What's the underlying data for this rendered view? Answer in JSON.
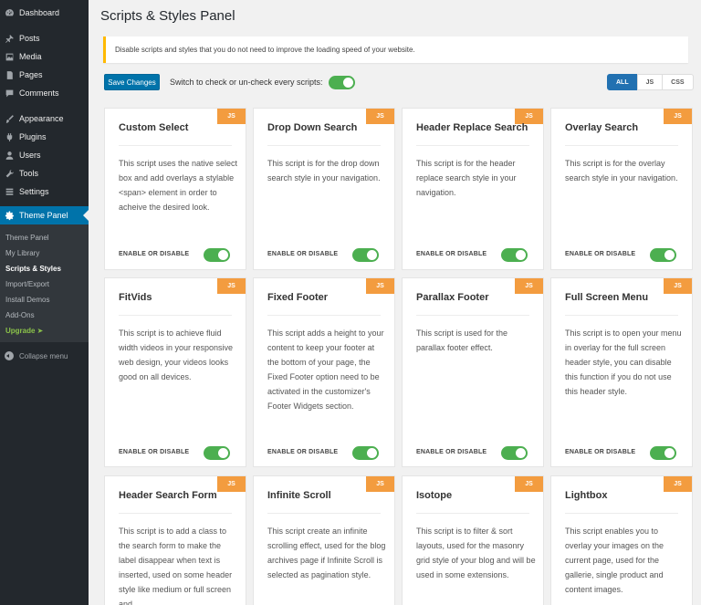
{
  "sidebar": {
    "items_top": [
      {
        "label": "Dashboard",
        "icon": "dashboard-icon"
      },
      {
        "label": "Posts",
        "icon": "pin-icon"
      },
      {
        "label": "Media",
        "icon": "media-icon"
      },
      {
        "label": "Pages",
        "icon": "pages-icon"
      },
      {
        "label": "Comments",
        "icon": "comments-icon"
      },
      {
        "label": "Appearance",
        "icon": "brush-icon"
      },
      {
        "label": "Plugins",
        "icon": "plugin-icon"
      },
      {
        "label": "Users",
        "icon": "users-icon"
      },
      {
        "label": "Tools",
        "icon": "wrench-icon"
      },
      {
        "label": "Settings",
        "icon": "settings-icon"
      }
    ],
    "theme_panel": {
      "label": "Theme Panel",
      "icon": "gear-icon"
    },
    "submenu": [
      "Theme Panel",
      "My Library",
      "Scripts & Styles",
      "Import/Export",
      "Install Demos",
      "Add-Ons"
    ],
    "upgrade": "Upgrade ➤",
    "collapse": "Collapse menu"
  },
  "page": {
    "title": "Scripts & Styles Panel",
    "notice": "Disable scripts and styles that you do not need to improve the loading speed of your website.",
    "save_label": "Save Changes",
    "switch_label": "Switch to check or un-check every scripts:",
    "filters": [
      "ALL",
      "JS",
      "CSS"
    ]
  },
  "cards": [
    {
      "title": "Custom Select",
      "badge": "JS",
      "desc": "This script uses the native select box and add overlays a stylable <span> element in order to acheive the desired look.",
      "enable_label": "ENABLE OR DISABLE"
    },
    {
      "title": "Drop Down Search",
      "badge": "JS",
      "desc": "This script is for the drop down search style in your navigation.",
      "enable_label": "ENABLE OR DISABLE"
    },
    {
      "title": "Header Replace Search",
      "badge": "JS",
      "desc": "This script is for the header replace search style in your navigation.",
      "enable_label": "ENABLE OR DISABLE"
    },
    {
      "title": "Overlay Search",
      "badge": "JS",
      "desc": "This script is for the overlay search style in your navigation.",
      "enable_label": "ENABLE OR DISABLE"
    },
    {
      "title": "FitVids",
      "badge": "JS",
      "desc": "This script is to achieve fluid width videos in your responsive web design, your videos looks good on all devices.",
      "enable_label": "ENABLE OR DISABLE"
    },
    {
      "title": "Fixed Footer",
      "badge": "JS",
      "desc": "This script adds a height to your content to keep your footer at the bottom of your page, the Fixed Footer option need to be activated in the customizer's Footer Widgets section.",
      "enable_label": "ENABLE OR DISABLE"
    },
    {
      "title": "Parallax Footer",
      "badge": "JS",
      "desc": "This script is used for the parallax footer effect.",
      "enable_label": "ENABLE OR DISABLE"
    },
    {
      "title": "Full Screen Menu",
      "badge": "JS",
      "desc": "This script is to open your menu in overlay for the full screen header style, you can disable this function if you do not use this header style.",
      "enable_label": "ENABLE OR DISABLE"
    },
    {
      "title": "Header Search Form",
      "badge": "JS",
      "desc": "This script is to add a class to the search form to make the label disappear when text is inserted, used on some header style like medium or full screen and",
      "enable_label": ""
    },
    {
      "title": "Infinite Scroll",
      "badge": "JS",
      "desc": "This script create an infinite scrolling effect, used for the blog archives page if Infinite Scroll is selected as pagination style.",
      "enable_label": ""
    },
    {
      "title": "Isotope",
      "badge": "JS",
      "desc": "This script is to filter & sort layouts, used for the masonry grid style of your blog and will be used in some extensions.",
      "enable_label": ""
    },
    {
      "title": "Lightbox",
      "badge": "JS",
      "desc": "This script enables you to overlay your images on the current page, used for the gallerie, single product and content images.",
      "enable_label": ""
    }
  ],
  "colors": {
    "accent": "#0073aa",
    "toggle_on": "#4caf50",
    "badge": "#f39c3f",
    "sidebar": "#23282d"
  }
}
